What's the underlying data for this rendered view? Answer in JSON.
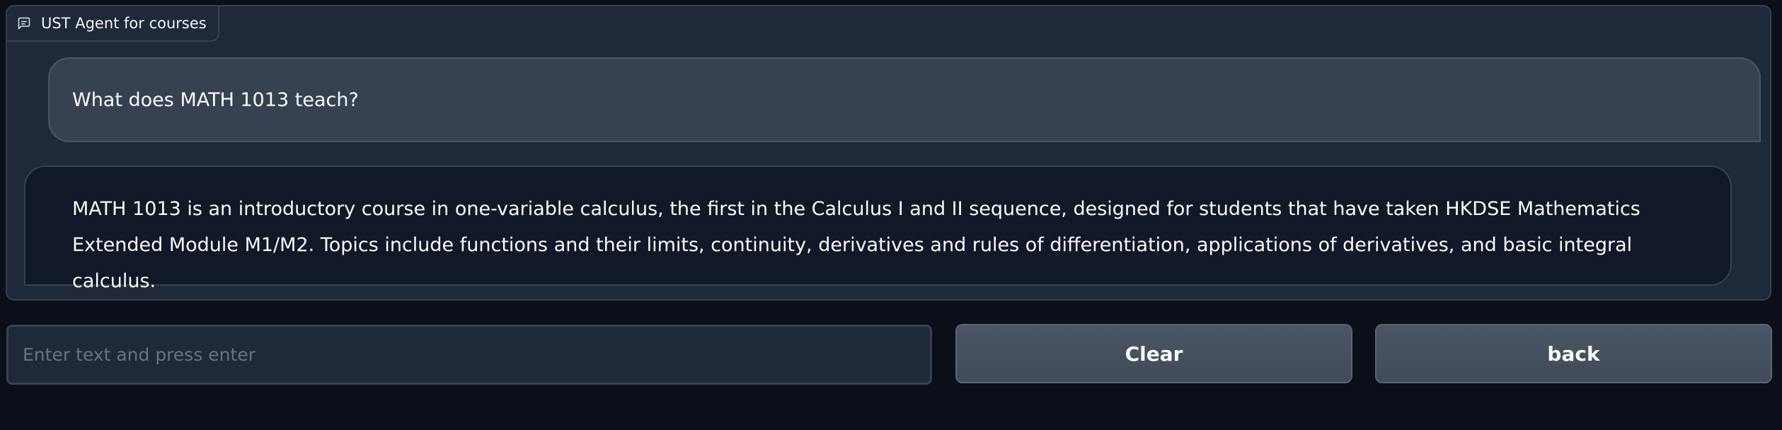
{
  "chat": {
    "label": "UST Agent for courses",
    "label_icon": "chat-bubble-icon",
    "messages": [
      {
        "role": "user",
        "text": "What does MATH 1013 teach?"
      },
      {
        "role": "bot",
        "text": "MATH 1013 is an introductory course in one-variable calculus, the first in the Calculus I and II sequence, designed for students that have taken HKDSE Mathematics Extended Module M1/M2. Topics include functions and their limits, continuity, derivatives and rules of differentiation, applications of derivatives, and basic integral calculus."
      }
    ]
  },
  "input": {
    "value": "",
    "placeholder": "Enter text and press enter"
  },
  "buttons": {
    "clear_label": "Clear",
    "back_label": "back"
  },
  "colors": {
    "background": "#0b0f19",
    "panel": "#1f2937",
    "user_bubble": "#374151",
    "bot_bubble": "#111827",
    "button": "#4b5563"
  }
}
